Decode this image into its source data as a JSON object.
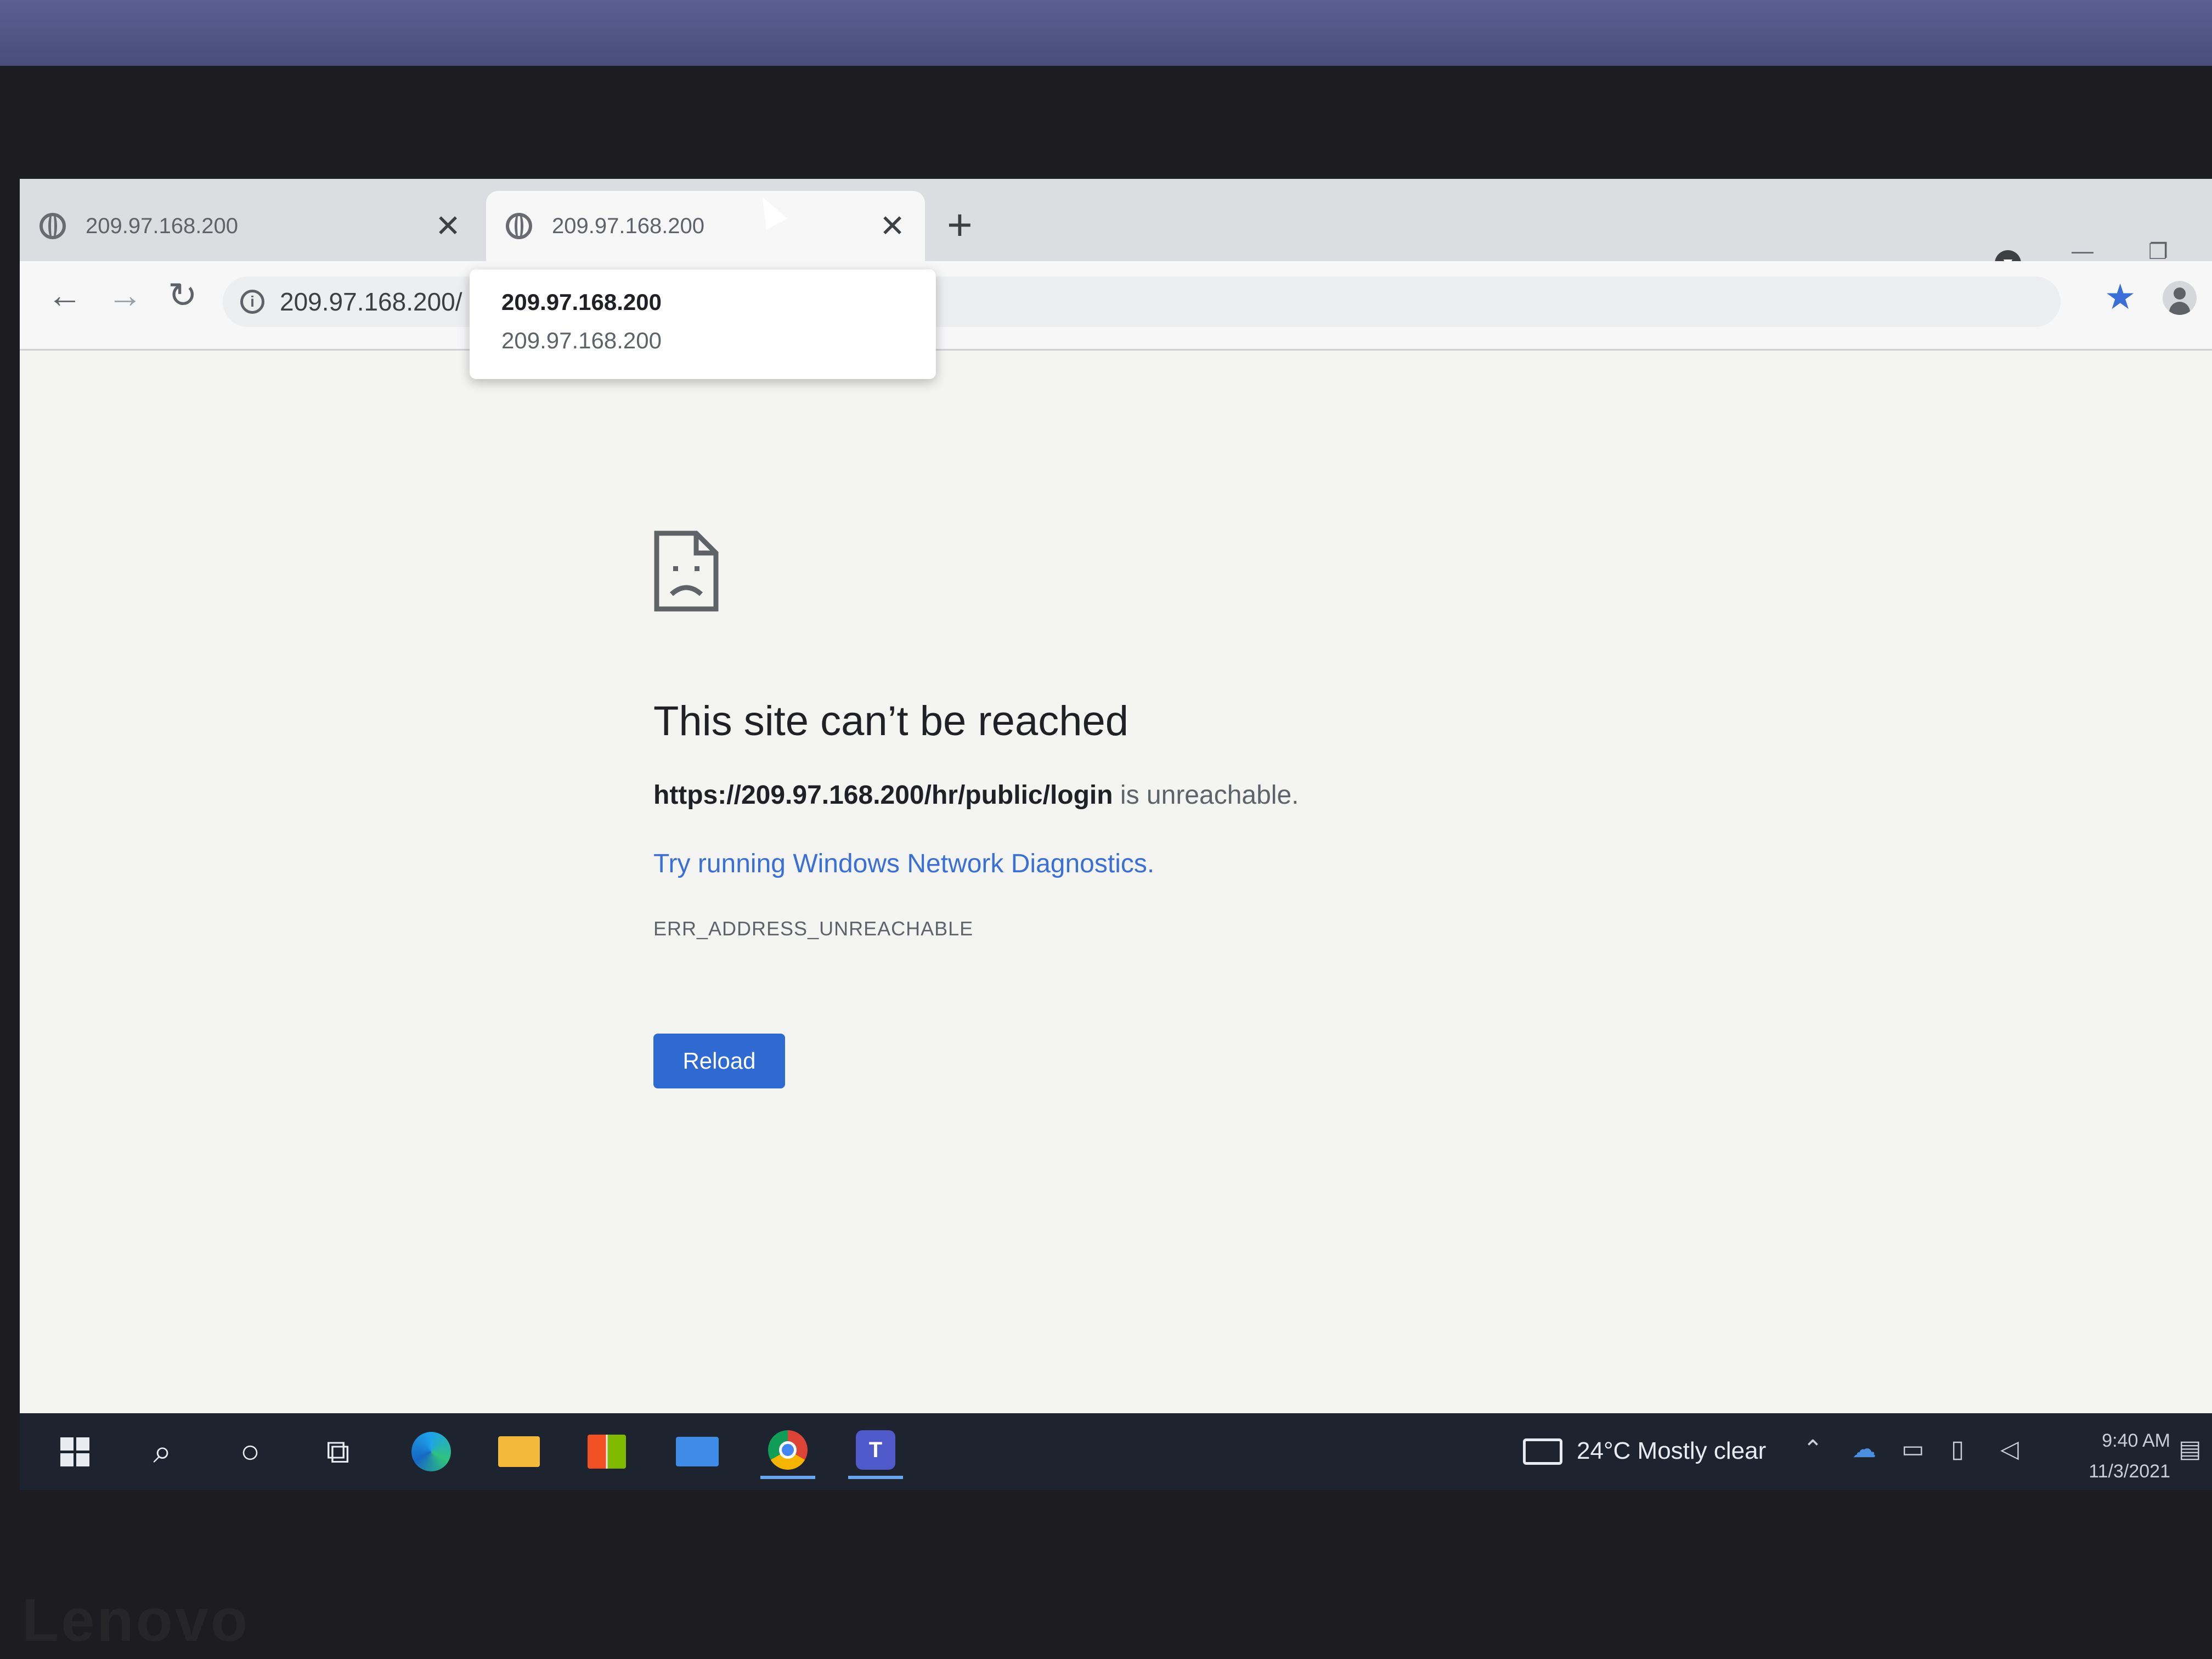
{
  "browser": {
    "tabs": [
      {
        "title": "209.97.168.200",
        "close": "✕",
        "active": false
      },
      {
        "title": "209.97.168.200",
        "close": "✕",
        "active": true
      }
    ],
    "new_tab": "+",
    "url": "209.97.168.200/",
    "tooltip": {
      "title": "209.97.168.200",
      "subtitle": "209.97.168.200"
    }
  },
  "toolbar_icons": [
    "back-arrow-icon",
    "forward-arrow-icon",
    "reload-icon",
    "info-icon",
    "star-icon",
    "profile-icon"
  ],
  "error_page": {
    "title": "This site can’t be reached",
    "url_bold": "https://209.97.168.200/hr/public/login",
    "url_suffix": " is unreachable.",
    "diagnostics_link": "Try running Windows Network Diagnostics.",
    "error_code": "ERR_ADDRESS_UNREACHABLE",
    "reload_label": "Reload"
  },
  "taskbar": {
    "weather": "24°C  Mostly clear",
    "time": "9:40 AM",
    "date": "11/3/2021"
  },
  "device": {
    "brand": "Lenovo"
  },
  "colors": {
    "link": "#3b6fd8",
    "reload_button": "#2f6ad3",
    "star": "#3b6fd8",
    "taskbar": "#1e2330"
  }
}
